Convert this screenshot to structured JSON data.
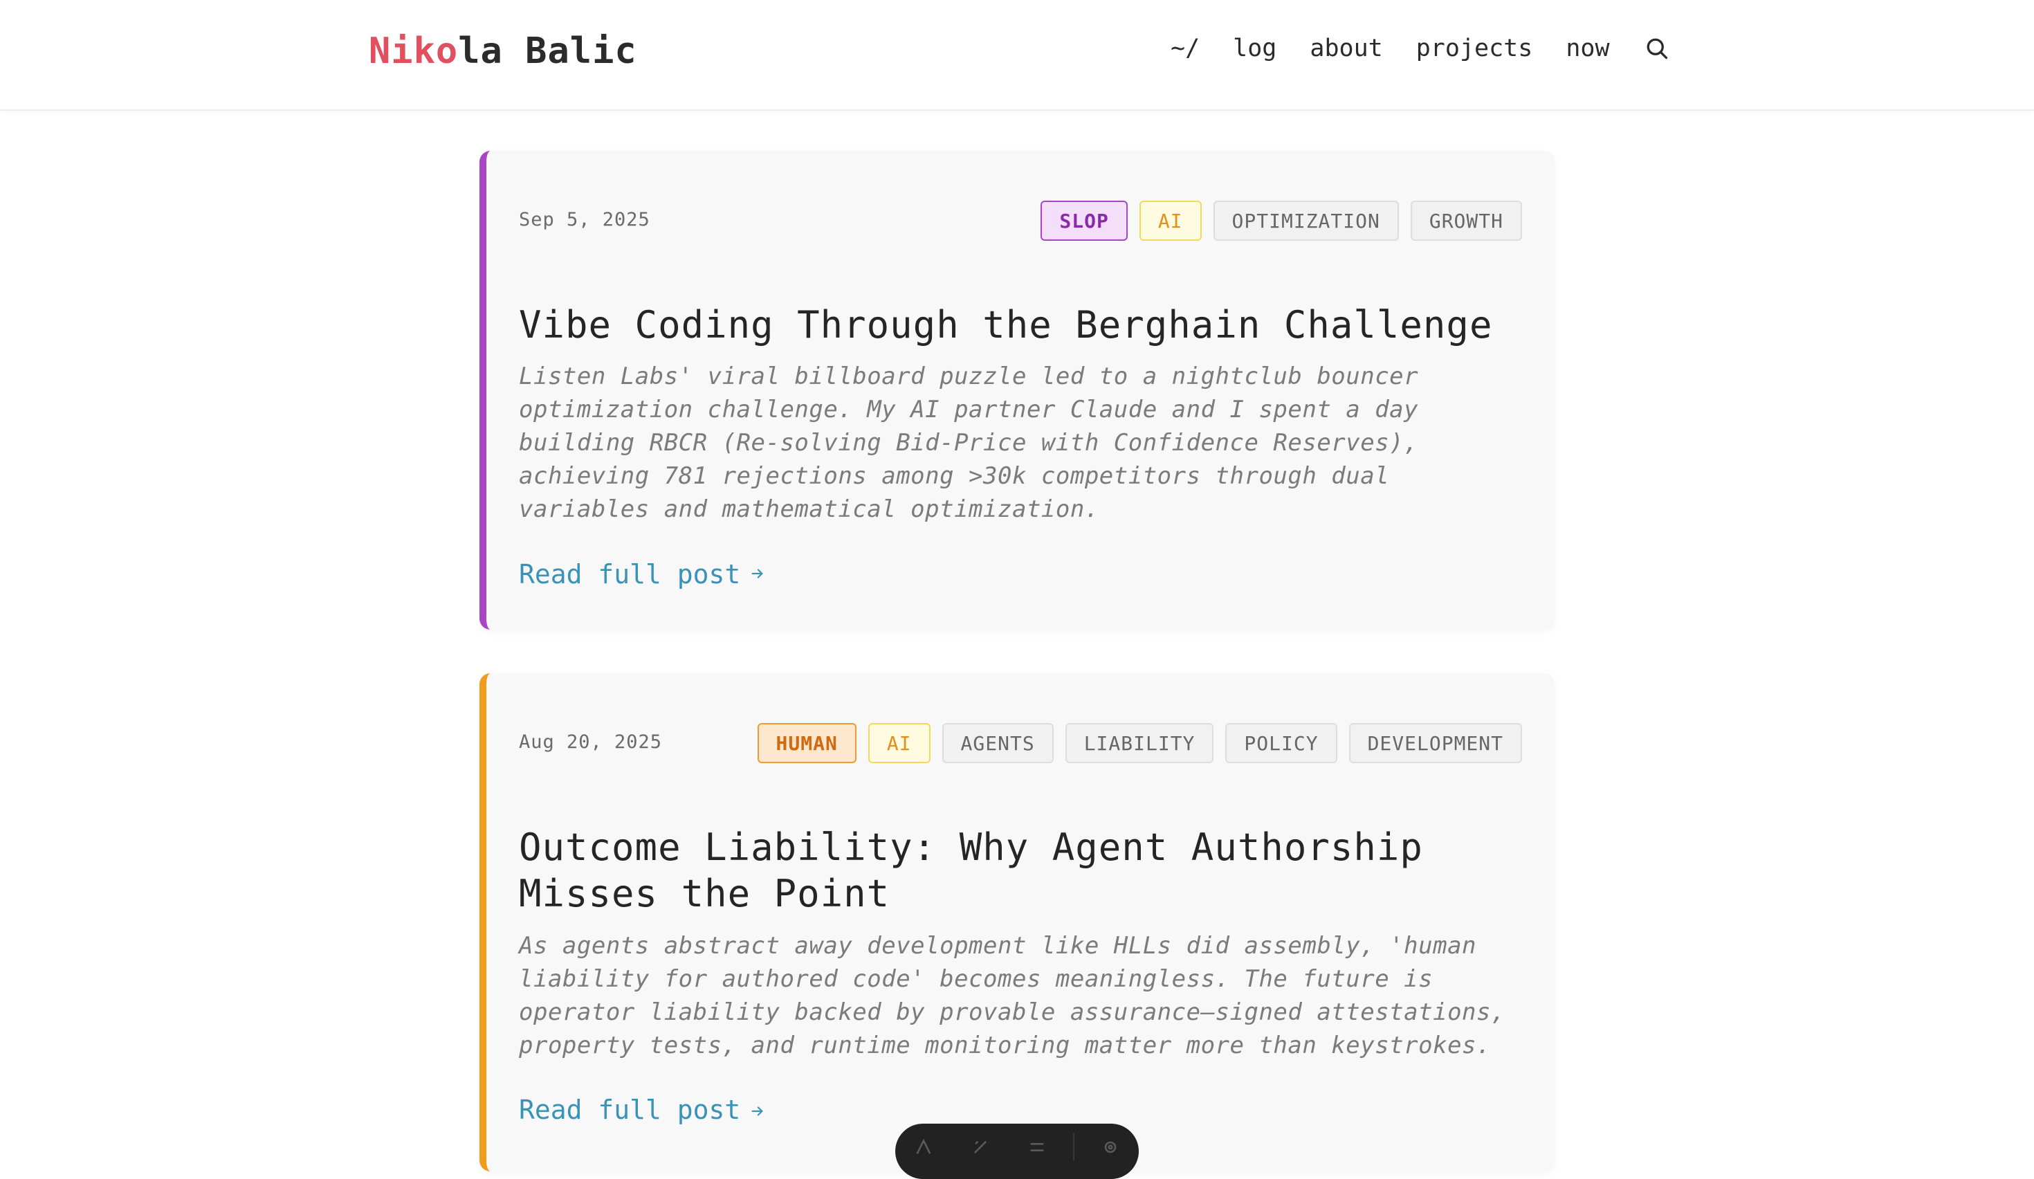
{
  "header": {
    "logo_accent": "Niko",
    "logo_rest": "la Balic",
    "nav": [
      {
        "label": "~/"
      },
      {
        "label": "log"
      },
      {
        "label": "about"
      },
      {
        "label": "projects"
      },
      {
        "label": "now"
      }
    ],
    "search_icon": "search-icon"
  },
  "posts": [
    {
      "date": "Sep 5, 2025",
      "tags": [
        "SLOP",
        "AI",
        "OPTIMIZATION",
        "GROWTH"
      ],
      "title": "Vibe Coding Through the Berghain Challenge",
      "excerpt": "Listen Labs' viral billboard puzzle led to a nightclub bouncer optimization challenge. My AI partner Claude and I spent a day building RBCR (Re-solving Bid-Price with Confidence Reserves), achieving 781 rejections among >30k competitors through dual variables and mathematical optimization.",
      "read_more": "Read full post",
      "accent_color": "#a946c4"
    },
    {
      "date": "Aug 20, 2025",
      "tags": [
        "HUMAN",
        "AI",
        "AGENTS",
        "LIABILITY",
        "POLICY",
        "DEVELOPMENT"
      ],
      "title": "Outcome Liability: Why Agent Authorship Misses the Point",
      "excerpt": "As agents abstract away development like HLLs did assembly, 'human liability for authored code' becomes meaningless. The future is operator liability backed by provable assurance—signed attestations, property tests, and runtime monitoring matter more than keystrokes.",
      "read_more": "Read full post",
      "accent_color": "#f29c1e"
    }
  ],
  "toolbar": {
    "icons": [
      "text-size-icon",
      "brush-icon",
      "menu-icon",
      "settings-icon"
    ]
  }
}
